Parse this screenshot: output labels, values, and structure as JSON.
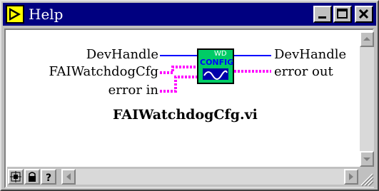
{
  "window": {
    "title": "Help"
  },
  "diagram": {
    "inputs": [
      "DevHandle",
      "FAIWatchdogCfg",
      "error in"
    ],
    "outputs": [
      "DevHandle",
      "error out"
    ],
    "icon_text": [
      "WD",
      "CONFIG"
    ],
    "vi_name": "FAIWatchdogCfg.vi"
  },
  "toolbar": {
    "buttons": [
      "show-simple-help-icon",
      "lock-icon",
      "help-question-icon"
    ]
  },
  "colors": {
    "titlebar": "#000080",
    "wire_blue": "#0000ff",
    "wire_pink": "#ff00ff",
    "vi_icon_bg": "#00cc66"
  }
}
